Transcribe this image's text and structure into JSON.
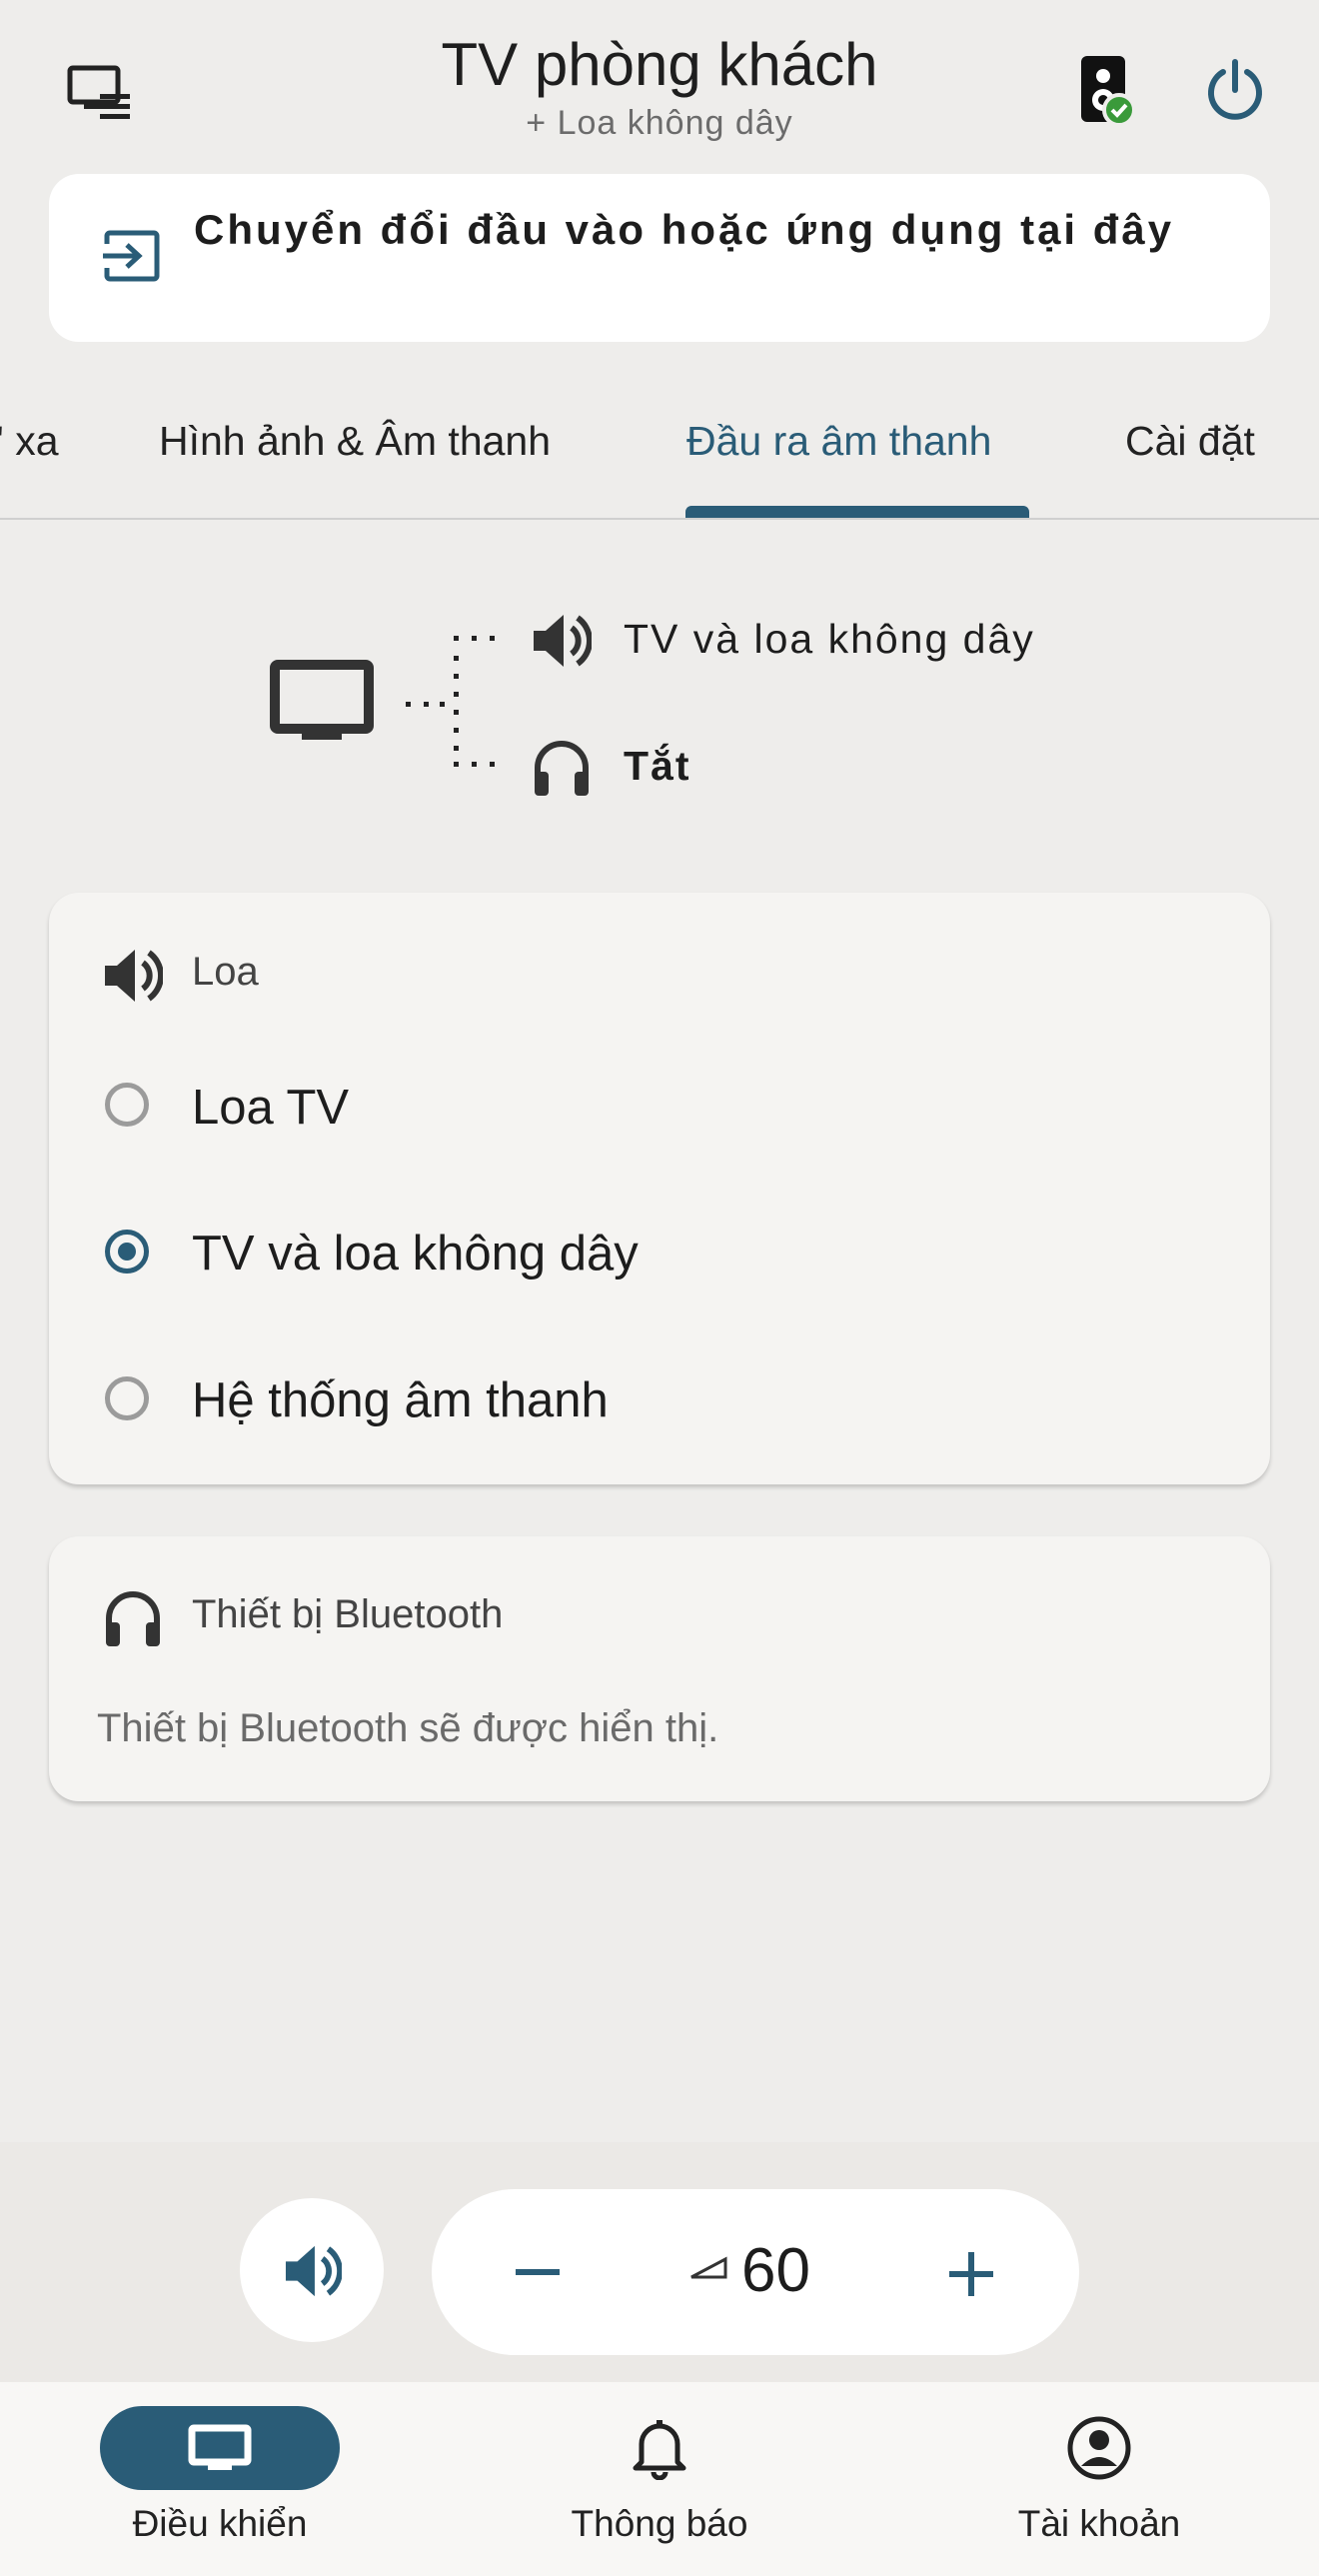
{
  "header": {
    "title": "TV phòng khách",
    "subtitle": "+ Loa không dây"
  },
  "input_switch": {
    "label": "Chuyển đổi đầu vào hoặc ứng dụng tại đây"
  },
  "tabs": [
    {
      "label": "Điều khiển từ xa",
      "visible_text": "' xa",
      "active": false
    },
    {
      "label": "Hình ảnh & Âm thanh",
      "active": false
    },
    {
      "label": "Đầu ra âm thanh",
      "active": true
    },
    {
      "label": "Cài đặt",
      "active": false
    }
  ],
  "output_diagram": {
    "speaker_output": "TV và loa không dây",
    "headphone_output": "Tắt"
  },
  "speaker_card": {
    "title": "Loa",
    "options": [
      {
        "label": "Loa TV",
        "selected": false
      },
      {
        "label": "TV và loa không dây",
        "selected": true
      },
      {
        "label": "Hệ thống âm thanh",
        "selected": false
      }
    ]
  },
  "bluetooth_card": {
    "title": "Thiết bị Bluetooth",
    "description": "Thiết bị Bluetooth sẽ được hiển thị."
  },
  "volume": {
    "value": "60"
  },
  "bottom_nav": [
    {
      "label": "Điều khiển",
      "active": true
    },
    {
      "label": "Thông báo",
      "active": false
    },
    {
      "label": "Tài khoản",
      "active": false
    }
  ],
  "colors": {
    "accent": "#2a5c77",
    "background": "#eeedeb",
    "card": "#f5f4f2",
    "status_ok": "#3a9a3a"
  },
  "icons": {
    "header_left": "screen-list-icon",
    "header_speaker": "speaker-connected-icon",
    "header_power": "power-icon",
    "input": "input-switch-icon",
    "diagram_tv": "tv-icon",
    "diagram_speaker": "speaker-icon",
    "diagram_headphones": "headphones-icon",
    "volume_mute": "volume-icon",
    "nav_remote": "tv-icon",
    "nav_notifications": "bell-icon",
    "nav_account": "account-icon"
  }
}
